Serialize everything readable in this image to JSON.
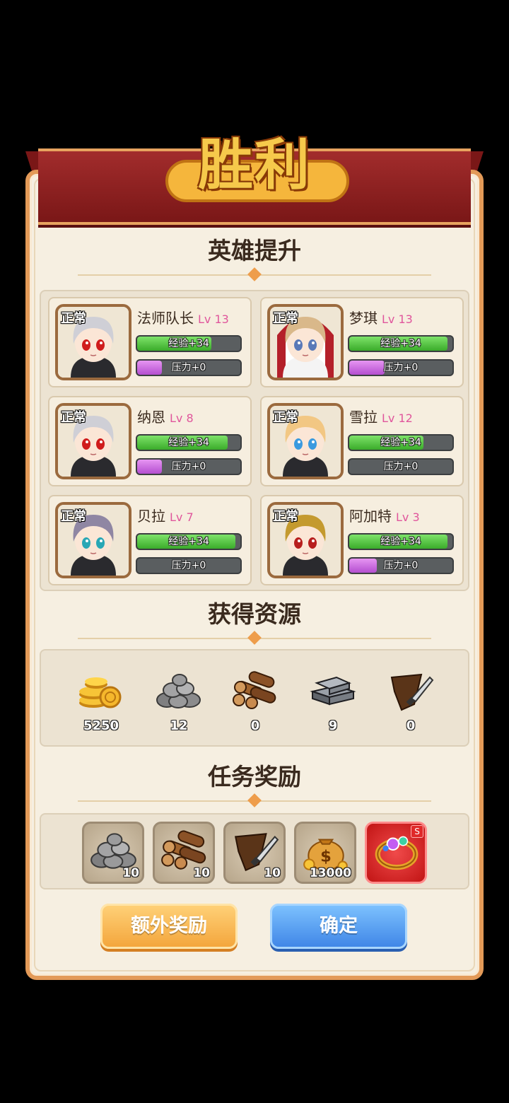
{
  "title": "胜利",
  "sections": {
    "heroes": "英雄提升",
    "resources": "获得资源",
    "tasks": "任务奖励"
  },
  "heroes": [
    {
      "status": "正常",
      "name": "法师队长",
      "level": "Lv 13",
      "exp": "经验+34",
      "exp_fill": 0.72,
      "stress": "压力+0",
      "stress_fill": 0.24,
      "portrait": "silver-hair-red-eyes",
      "hair": "#cfcfd6",
      "eye": "#d01c1c"
    },
    {
      "status": "正常",
      "name": "梦琪",
      "level": "Lv 13",
      "exp": "经验+34",
      "exp_fill": 0.95,
      "stress": "压力+0",
      "stress_fill": 0.34,
      "portrait": "red-hood-nun",
      "hair": "#d9b88a",
      "eye": "#5a79b8"
    },
    {
      "status": "正常",
      "name": "纳恩",
      "level": "Lv 8",
      "exp": "经验+34",
      "exp_fill": 0.88,
      "stress": "压力+0",
      "stress_fill": 0.24,
      "portrait": "silver-hair-red-eyes",
      "hair": "#cfcfd6",
      "eye": "#d01c1c"
    },
    {
      "status": "正常",
      "name": "雪拉",
      "level": "Lv 12",
      "exp": "经验+34",
      "exp_fill": 0.72,
      "stress": "压力+0",
      "stress_fill": 0.0,
      "portrait": "blonde-bob-blue-eyes",
      "hair": "#f2c783",
      "eye": "#3b9adf"
    },
    {
      "status": "正常",
      "name": "贝拉",
      "level": "Lv 7",
      "exp": "经验+34",
      "exp_fill": 0.95,
      "stress": "压力+0",
      "stress_fill": 0.0,
      "portrait": "lavender-hair-teal-eyes",
      "hair": "#8f86a3",
      "eye": "#2aa7b5"
    },
    {
      "status": "正常",
      "name": "阿加特",
      "level": "Lv 3",
      "exp": "经验+34",
      "exp_fill": 0.95,
      "stress": "压力+0",
      "stress_fill": 0.27,
      "portrait": "golden-hair-red-eyes",
      "hair": "#c49a2f",
      "eye": "#b81e1e"
    }
  ],
  "resources": [
    {
      "icon": "gold-coins-icon",
      "value": "5250"
    },
    {
      "icon": "stone-pile-icon",
      "value": "12"
    },
    {
      "icon": "wood-logs-icon",
      "value": "0"
    },
    {
      "icon": "iron-ingot-icon",
      "value": "9"
    },
    {
      "icon": "leather-hide-icon",
      "value": "0"
    }
  ],
  "task_rewards": [
    {
      "icon": "stone-pile-icon",
      "qty": "10"
    },
    {
      "icon": "wood-logs-icon",
      "qty": "10"
    },
    {
      "icon": "leather-hide-icon",
      "qty": "10"
    },
    {
      "icon": "money-bag-icon",
      "qty": "13000"
    },
    {
      "icon": "jeweled-ring-icon",
      "qty": "",
      "badge": "S"
    }
  ],
  "buttons": {
    "extra": "额外奖励",
    "confirm": "确定"
  },
  "colors": {
    "frame": "#e39a58",
    "ribbon": "#a22c2c",
    "exp_bar": "#4dc03a",
    "stress_bar": "#c86ae0",
    "level_text": "#e0569c"
  }
}
